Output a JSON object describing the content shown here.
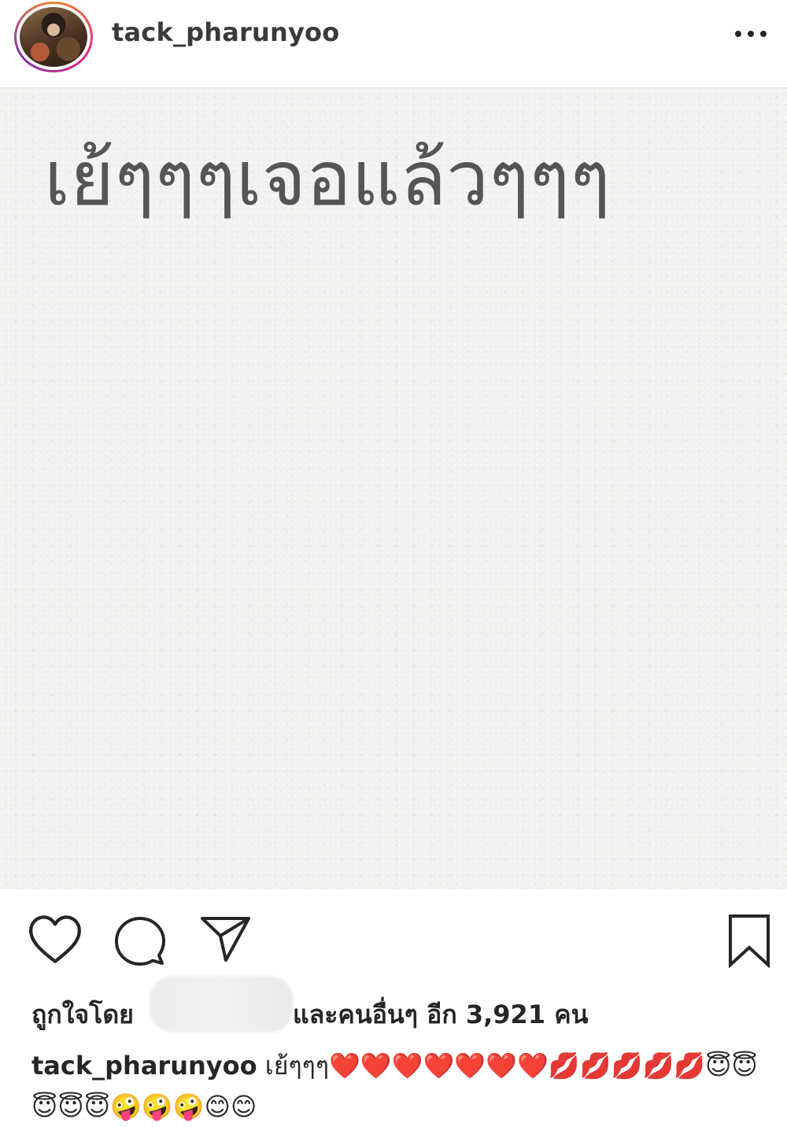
{
  "header": {
    "username": "tack_pharunyoo",
    "more_icon": "more-horizontal-icon"
  },
  "post": {
    "image_text": "เย้ๆๆๆเจอแล้วๆๆๆ"
  },
  "actions": {
    "icons": [
      "heart-icon",
      "comment-icon",
      "share-icon",
      "bookmark-icon"
    ]
  },
  "likes": {
    "prefix": "ถูกใจโดย",
    "suffix": "และคนอื่นๆ อีก 3,921 คน"
  },
  "caption": {
    "username": "tack_pharunyoo",
    "text": "เย้ๆๆๆ❤️❤️❤️❤️❤️❤️❤️💋💋💋💋💋😇😇😇😇😇🤪🤪🤪😊😊"
  }
}
